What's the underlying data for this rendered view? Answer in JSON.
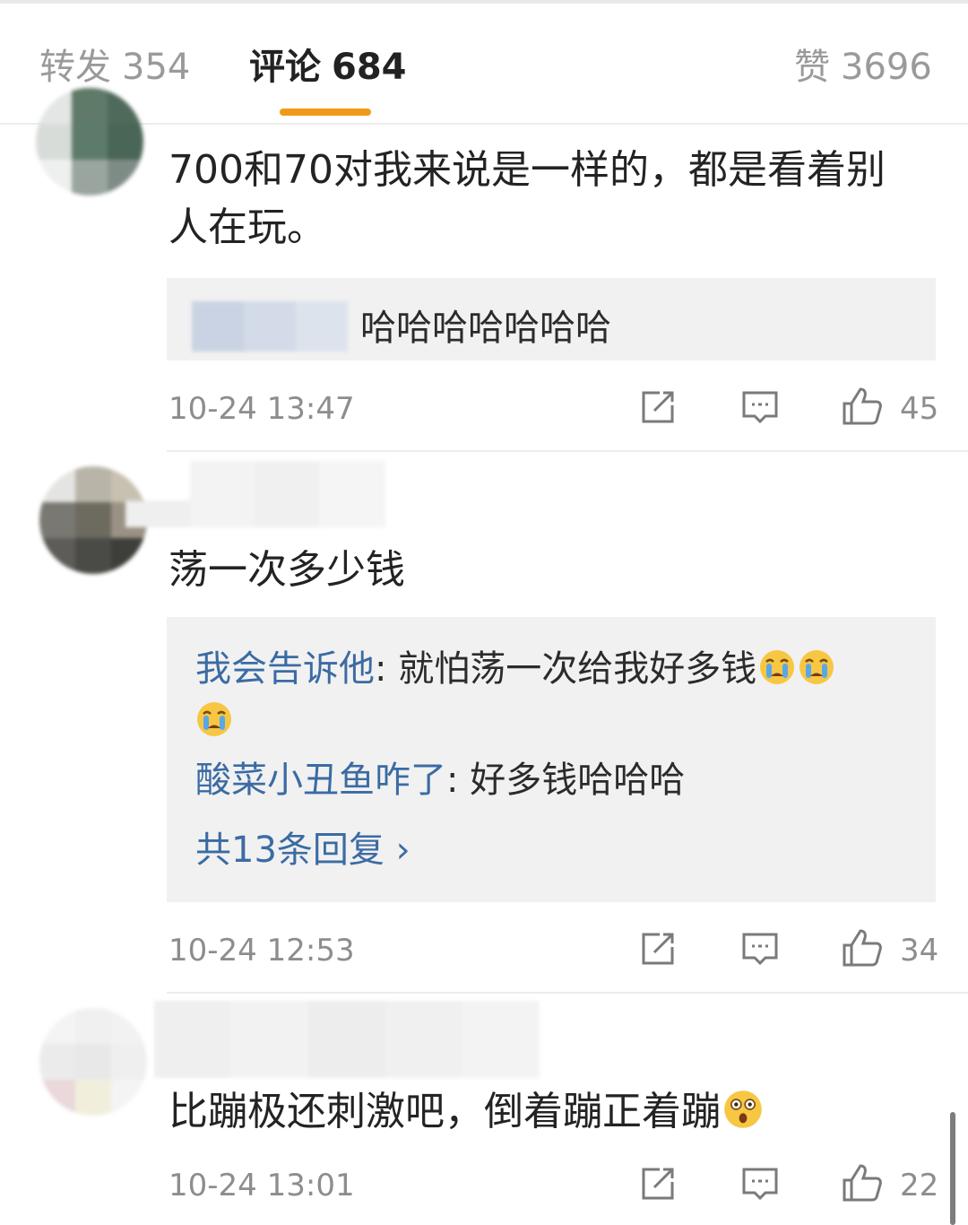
{
  "tabs": [
    {
      "label": "转发",
      "count": "354"
    },
    {
      "label": "评论",
      "count": "684"
    },
    {
      "label": "赞",
      "count": "3696"
    }
  ],
  "comments": [
    {
      "text": "700和70对我来说是一样的，都是看着别人在玩。",
      "reply_preview_text": "哈哈哈哈哈哈哈",
      "time": "10-24 13:47",
      "likes": "45"
    },
    {
      "text": "荡一次多少钱",
      "replies": [
        {
          "user": "我会告诉他",
          "sep": ": ",
          "text": "就怕荡一次给我好多钱"
        },
        {
          "user": "酸菜小丑鱼咋了",
          "sep": ": ",
          "text": "好多钱哈哈哈"
        }
      ],
      "more_replies": "共13条回复 ›",
      "time": "10-24 12:53",
      "likes": "34"
    },
    {
      "text": "比蹦极还刺激吧，倒着蹦正着蹦",
      "time": "10-24 13:01",
      "likes": "22"
    }
  ],
  "icons": {
    "repost": "repost-icon",
    "reply": "comment-icon",
    "like": "thumbs-up-icon",
    "crying": "crying-face-emoji",
    "surprised": "astonished-face-emoji"
  },
  "colors": {
    "accent": "#f09a1a",
    "link": "#3b6ba3",
    "muted": "#8d8d8d"
  }
}
